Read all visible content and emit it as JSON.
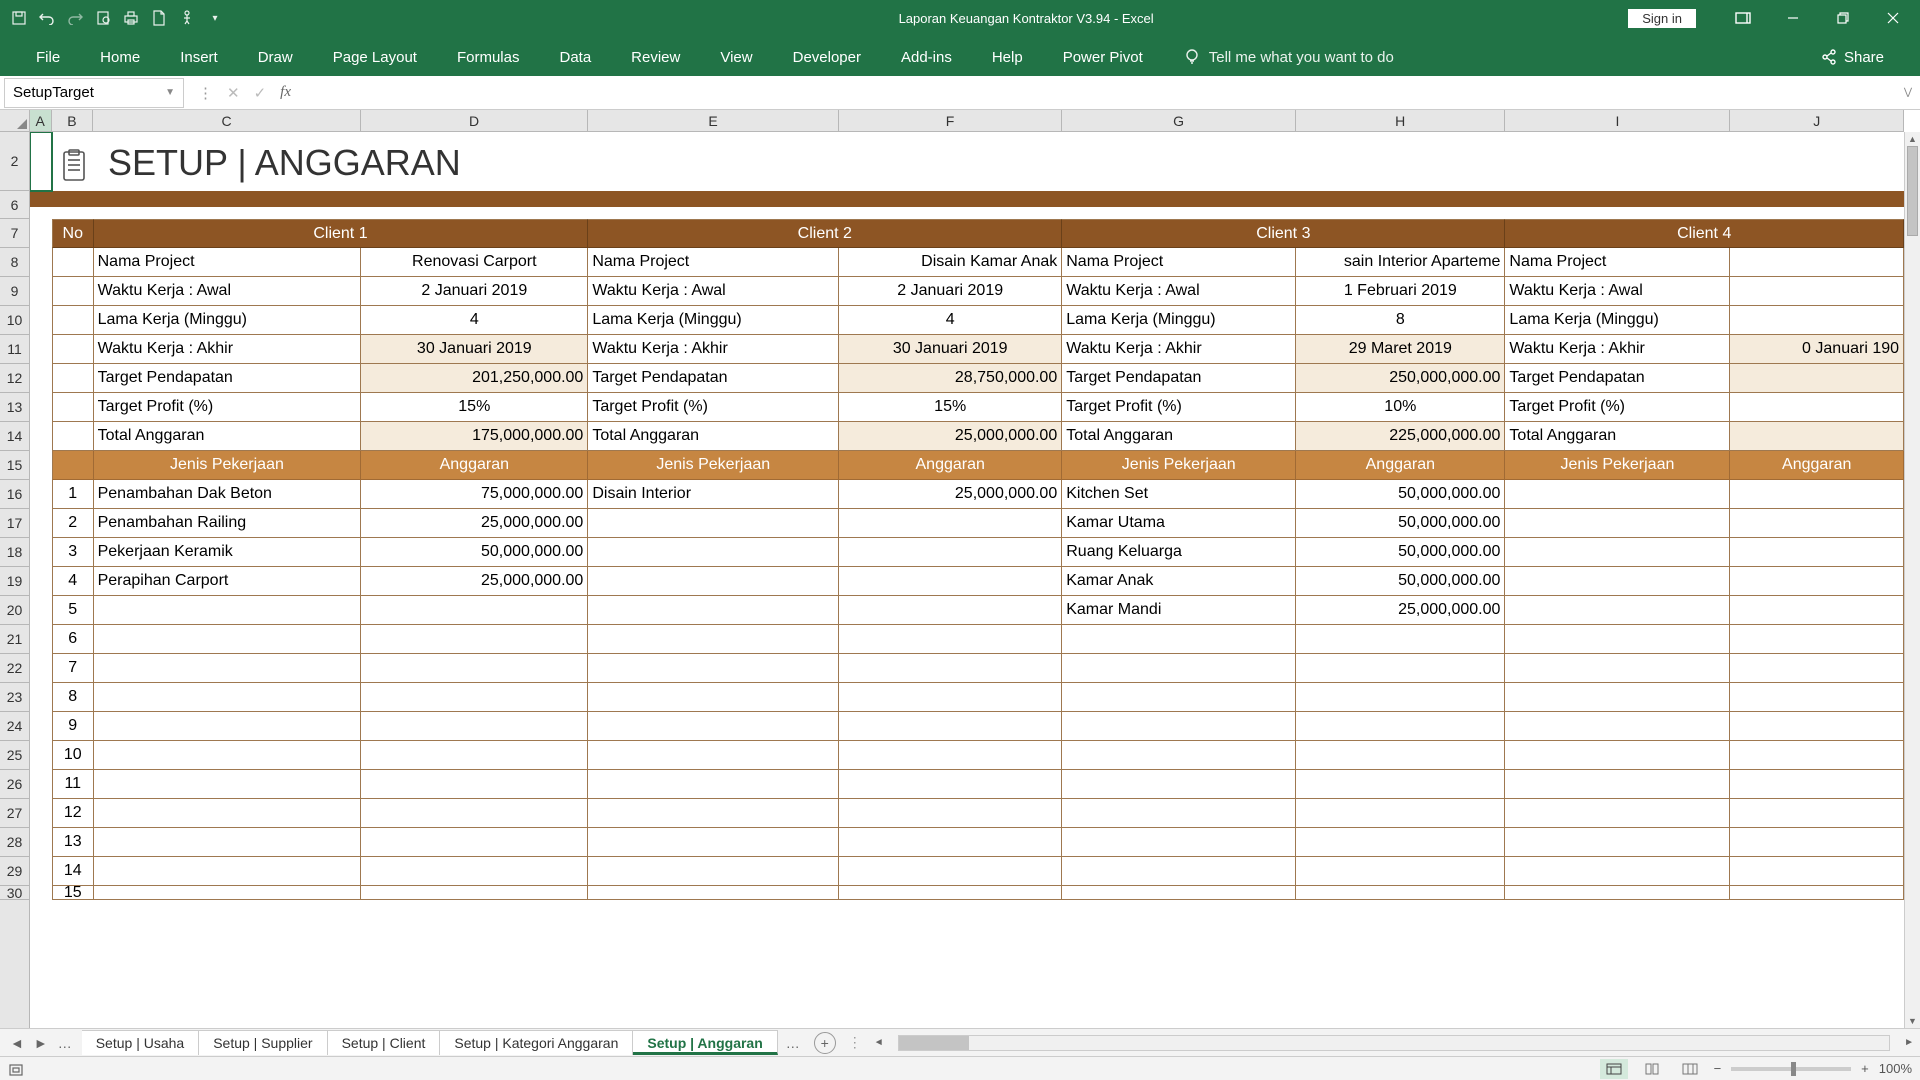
{
  "titlebar": {
    "doc_title": "Laporan Keuangan Kontraktor V3.94  -  Excel",
    "signin": "Sign in"
  },
  "ribbon": {
    "tabs": [
      "File",
      "Home",
      "Insert",
      "Draw",
      "Page Layout",
      "Formulas",
      "Data",
      "Review",
      "View",
      "Developer",
      "Add-ins",
      "Help",
      "Power Pivot"
    ],
    "tellme": "Tell me what you want to do",
    "share": "Share"
  },
  "namebox": "SetupTarget",
  "formula": "",
  "columns": [
    "A",
    "B",
    "C",
    "D",
    "E",
    "F",
    "G",
    "H",
    "I",
    "J"
  ],
  "rows": [
    "2",
    "6",
    "7",
    "8",
    "9",
    "10",
    "11",
    "12",
    "13",
    "14",
    "15",
    "16",
    "17",
    "18",
    "19",
    "20",
    "21",
    "22",
    "23",
    "24",
    "25",
    "26",
    "27",
    "28",
    "29",
    "30"
  ],
  "page_title": "SETUP | ANGGARAN",
  "headers": {
    "no": "No",
    "c1": "Client 1",
    "c2": "Client 2",
    "c3": "Client 3",
    "c4": "Client 4"
  },
  "labels": {
    "nama": "Nama Project",
    "awal": "Waktu Kerja : Awal",
    "lama": "Lama Kerja (Minggu)",
    "akhir": "Waktu Kerja : Akhir",
    "pendapatan": "Target Pendapatan",
    "profit": "Target Profit (%)",
    "total": "Total Anggaran",
    "jenis": "Jenis Pekerjaan",
    "anggaran": "Anggaran"
  },
  "client1": {
    "nama": "Renovasi Carport",
    "awal": "2 Januari 2019",
    "lama": "4",
    "akhir": "30 Januari 2019",
    "pendapatan": "201,250,000.00",
    "profit": "15%",
    "total": "175,000,000.00",
    "items": [
      {
        "no": "1",
        "nm": "Penambahan Dak Beton",
        "ang": "75,000,000.00"
      },
      {
        "no": "2",
        "nm": "Penambahan Railing",
        "ang": "25,000,000.00"
      },
      {
        "no": "3",
        "nm": "Pekerjaan Keramik",
        "ang": "50,000,000.00"
      },
      {
        "no": "4",
        "nm": "Perapihan Carport",
        "ang": "25,000,000.00"
      }
    ]
  },
  "client2": {
    "nama": "Disain Kamar Anak",
    "awal": "2 Januari 2019",
    "lama": "4",
    "akhir": "30 Januari 2019",
    "pendapatan": "28,750,000.00",
    "profit": "15%",
    "total": "25,000,000.00",
    "items": [
      {
        "nm": "Disain Interior",
        "ang": "25,000,000.00"
      }
    ]
  },
  "client3": {
    "nama": "sain Interior Aparteme",
    "awal": "1 Februari 2019",
    "lama": "8",
    "akhir": "29 Maret 2019",
    "pendapatan": "250,000,000.00",
    "profit": "10%",
    "total": "225,000,000.00",
    "items": [
      {
        "nm": "Kitchen Set",
        "ang": "50,000,000.00"
      },
      {
        "nm": "Kamar Utama",
        "ang": "50,000,000.00"
      },
      {
        "nm": "Ruang Keluarga",
        "ang": "50,000,000.00"
      },
      {
        "nm": "Kamar Anak",
        "ang": "50,000,000.00"
      },
      {
        "nm": "Kamar Mandi",
        "ang": "25,000,000.00"
      }
    ]
  },
  "client4": {
    "akhir": "0 Januari 190"
  },
  "row_nums": [
    "5",
    "6",
    "7",
    "8",
    "9",
    "10",
    "11",
    "12",
    "13",
    "14",
    "15"
  ],
  "sheet_tabs": [
    "Setup | Usaha",
    "Setup | Supplier",
    "Setup | Client",
    "Setup | Kategori Anggaran",
    "Setup | Anggaran"
  ],
  "active_tab": "Setup | Anggaran",
  "zoom": "100%"
}
